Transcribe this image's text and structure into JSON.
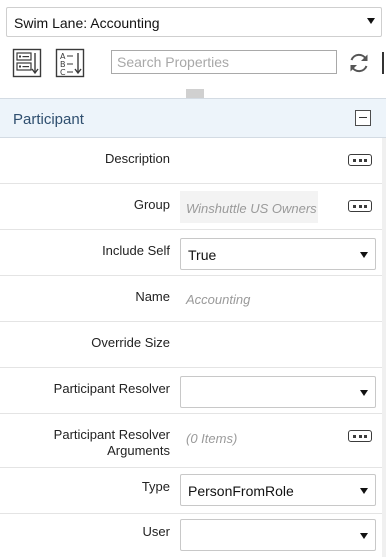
{
  "object_selector": {
    "value": "Swim Lane: Accounting"
  },
  "toolbar": {
    "categorized_icon": "categorized-view-icon",
    "alphabetical_icon": "alphabetical-sort-icon",
    "search_placeholder": "Search Properties",
    "refresh_icon": "refresh-icon"
  },
  "section": {
    "title": "Participant",
    "collapse_icon": "minus-icon"
  },
  "properties": [
    {
      "label": "Description",
      "value": "",
      "editor": "ellipsis"
    },
    {
      "label": "Group",
      "value": "Winshuttle US Owners",
      "editor": "ellipsis"
    },
    {
      "label": "Include Self",
      "value": "True",
      "editor": "dropdown"
    },
    {
      "label": "Name",
      "value": "Accounting",
      "editor": "text"
    },
    {
      "label": "Override Size",
      "value": "",
      "editor": "none"
    },
    {
      "label": "Participant Resolver",
      "value": "",
      "editor": "dropdown"
    },
    {
      "label_line1": "Participant Resolver",
      "label_line2": "Arguments",
      "value": "(0 Items)",
      "editor": "ellipsis"
    },
    {
      "label": "Type",
      "value": "PersonFromRole",
      "editor": "dropdown"
    },
    {
      "label": "User",
      "value": "",
      "editor": "dropdown"
    }
  ]
}
